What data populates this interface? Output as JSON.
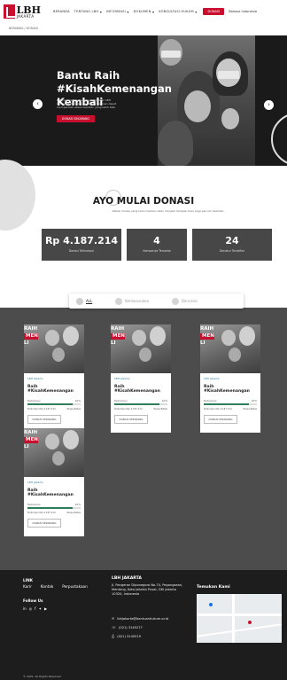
{
  "header": {
    "logo_big": "LBH",
    "logo_small": "JAKARTA",
    "nav": [
      {
        "label": "BERANDA",
        "caret": false
      },
      {
        "label": "TENTANG LBH",
        "caret": true
      },
      {
        "label": "INFORMASI",
        "caret": true
      },
      {
        "label": "DOKUMEN",
        "caret": true
      },
      {
        "label": "KONSULTASI HUKUM",
        "caret": true
      }
    ],
    "donasi_button": "DONASI",
    "language": "Bahasa Indonesia"
  },
  "breadcrumb": "BERANDA / DONASI",
  "hero": {
    "title": "Bantu Raih #KisahKemenangan Kembali",
    "description": "Program ini dirancang agar Yayasan LBH Indonesia dan para penerima bantuan dapat memperoleh akses keadilan yang lebih baik.",
    "button": "DONASI SEKARANG"
  },
  "donasi": {
    "title": "AYO MULAI DONASI",
    "subtitle": "Setiap donasi yang kamu berikan akan menjadi harapan baru bagi pencari keadilan."
  },
  "stats": [
    {
      "value": "Rp 4.187.214",
      "label": "Donasi Terkumpul"
    },
    {
      "value": "4",
      "label": "Kampanye Tersedia"
    },
    {
      "value": "24",
      "label": "Donatur Terdaftar"
    }
  ],
  "filters": [
    {
      "label": "ALL",
      "active": true
    },
    {
      "label": "Kemanusiaan",
      "active": false
    },
    {
      "label": "Bencana",
      "active": false
    }
  ],
  "campaigns": [
    {
      "org": "LBH Jakarta",
      "title": "Raih #KisahKemenangan",
      "collected_label": "Terkumpul",
      "percent_label": "10%",
      "progress": 0.1,
      "amount": "Terkumpul Rp 4.187.214",
      "days": "Tanpa Batas",
      "button": "DONASI SEKARANG",
      "img_tag_top": "RAIH",
      "img_tag_mid": "MENANGAN",
      "img_tag_bottom": "LI"
    },
    {
      "org": "LBH Jakarta",
      "title": "Raih #KisahKemenangan",
      "collected_label": "Terkumpul",
      "percent_label": "10%",
      "progress": 0.1,
      "amount": "Terkumpul Rp 4.187.214",
      "days": "Tanpa Batas",
      "button": "DONASI SEKARANG",
      "img_tag_top": "RAIH",
      "img_tag_mid": "MENANGAN",
      "img_tag_bottom": "LI"
    },
    {
      "org": "LBH Jakarta",
      "title": "Raih #KisahKemenangan",
      "collected_label": "Terkumpul",
      "percent_label": "10%",
      "progress": 0.1,
      "amount": "Terkumpul Rp 4.187.214",
      "days": "Tanpa Batas",
      "button": "DONASI SEKARANG",
      "img_tag_top": "RAIH",
      "img_tag_mid": "MENANGAN",
      "img_tag_bottom": "LI"
    },
    {
      "org": "LBH Jakarta",
      "title": "Raih #KisahKemenangan",
      "collected_label": "Terkumpul",
      "percent_label": "10%",
      "progress": 0.1,
      "amount": "Terkumpul Rp 4.187.214",
      "days": "Tanpa Batas",
      "button": "DONASI SEKARANG",
      "img_tag_top": "RAIH",
      "img_tag_mid": "MENANGAN",
      "img_tag_bottom": "LI"
    }
  ],
  "footer": {
    "link_title": "LINK",
    "links": [
      "Karir",
      "Kontak",
      "Perpustakaan"
    ],
    "follow_title": "Follow Us",
    "org_name": "LBH JAKARTA",
    "address": "Jl. Pangeran Diponegoro No.74, Pegangsaan, Menteng, Kota Jakarta Pusat, DKI Jakarta 10320, Indonesia",
    "email": "lbhjakarta@bantuanhukum.or.id",
    "phone": "(021) 3145277",
    "fax": "(021) 3145519",
    "find_title": "Temukan Kami",
    "copyright": "© 2022. All Rights Reserved."
  },
  "colors": {
    "accent": "#c8102e",
    "dark": "#4c4c4c",
    "footer": "#1d1d1d"
  }
}
